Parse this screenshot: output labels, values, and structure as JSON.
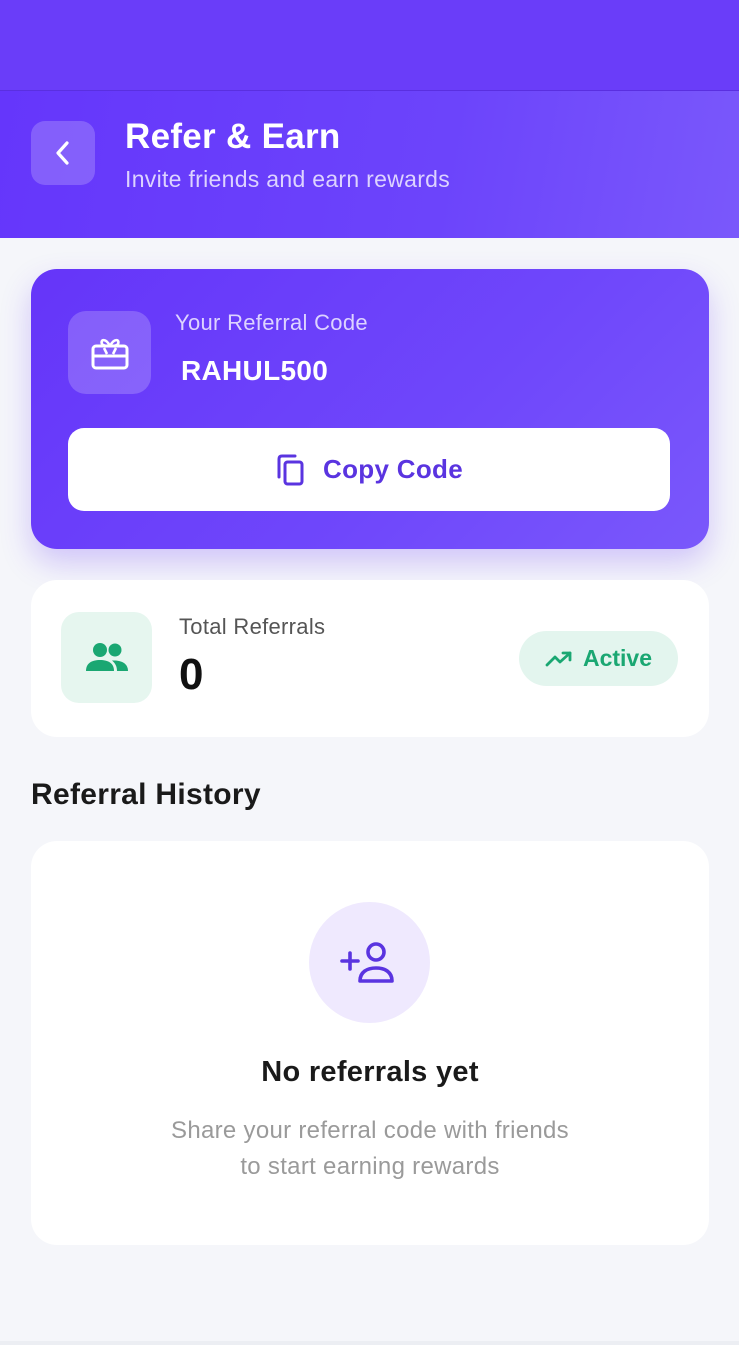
{
  "header": {
    "title": "Refer & Earn",
    "subtitle": "Invite friends and earn rewards",
    "back_icon": "chevron-left-icon"
  },
  "referral": {
    "label": "Your Referral Code",
    "code": "RAHUL500",
    "copy_label": "Copy Code",
    "icon": "gift-icon"
  },
  "stats": {
    "label": "Total Referrals",
    "value": "0",
    "badge": "Active",
    "icon": "people-icon"
  },
  "history": {
    "title": "Referral History",
    "empty_title": "No referrals yet",
    "empty_desc_line1": "Share your referral code with friends",
    "empty_desc_line2": "to start earning rewards"
  },
  "colors": {
    "primary": "#6536fb",
    "success": "#1aa772",
    "background": "#f5f6fa"
  }
}
